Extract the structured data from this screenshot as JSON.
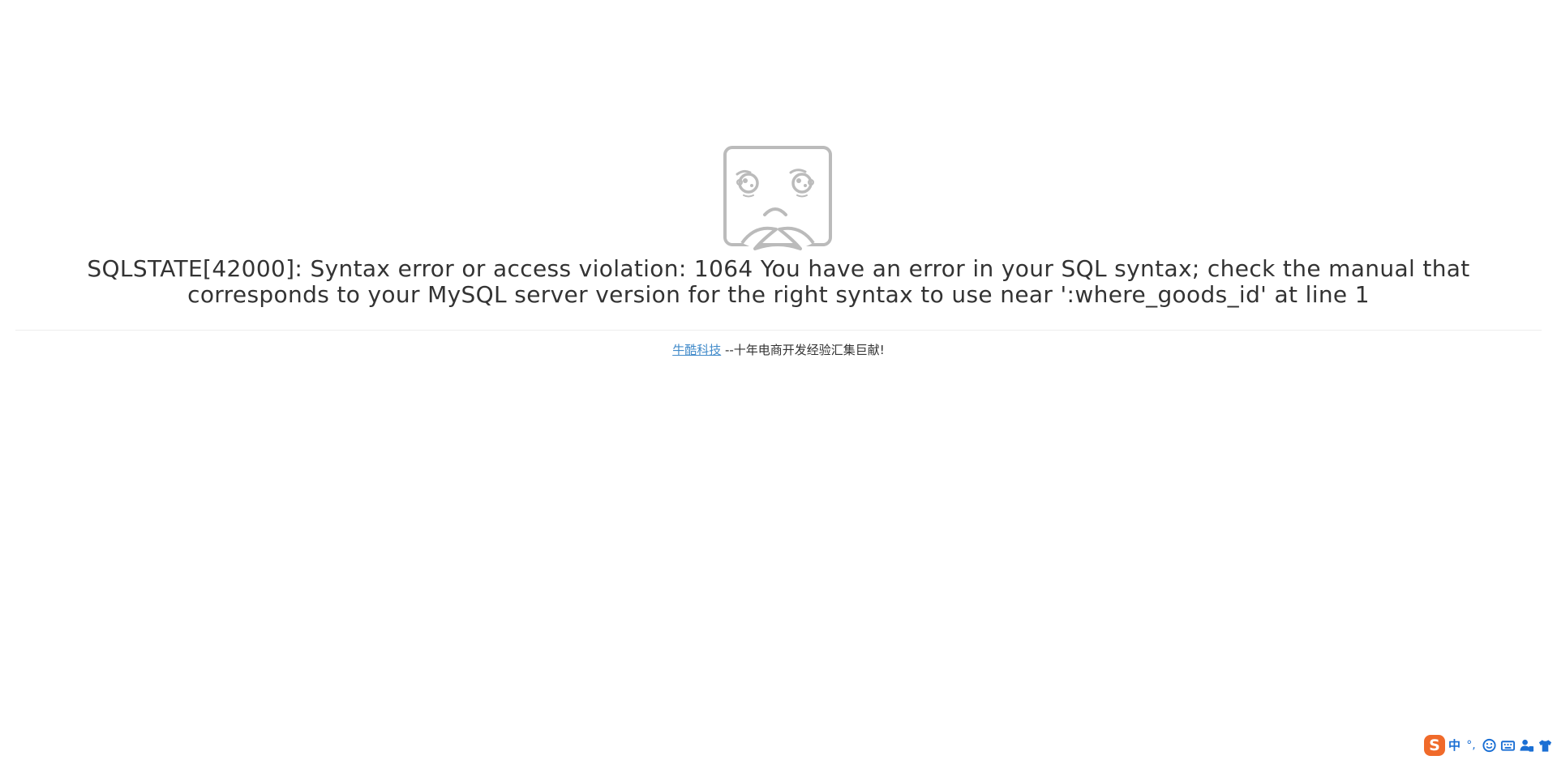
{
  "error": {
    "message": "SQLSTATE[42000]: Syntax error or access violation: 1064 You have an error in your SQL syntax; check the manual that corresponds to your MySQL server version for the right syntax to use near ':where_goods_id' at line 1",
    "icon": "sad-face-icon"
  },
  "footer": {
    "link_text": "牛酷科技",
    "tagline": " --十年电商开发经验汇集巨献!"
  },
  "ime_toolbar": {
    "logo": "S",
    "mode": "中",
    "punctuation": "°,",
    "icons": [
      "sogou-logo-icon",
      "smiley-icon",
      "keyboard-icon",
      "user-settings-icon",
      "skin-shirt-icon"
    ]
  },
  "colors": {
    "text": "#333333",
    "link": "#428bca",
    "icon_gray": "#bbbbbb",
    "ime_orange": "#f06a2a",
    "ime_blue": "#1a6fd4"
  }
}
